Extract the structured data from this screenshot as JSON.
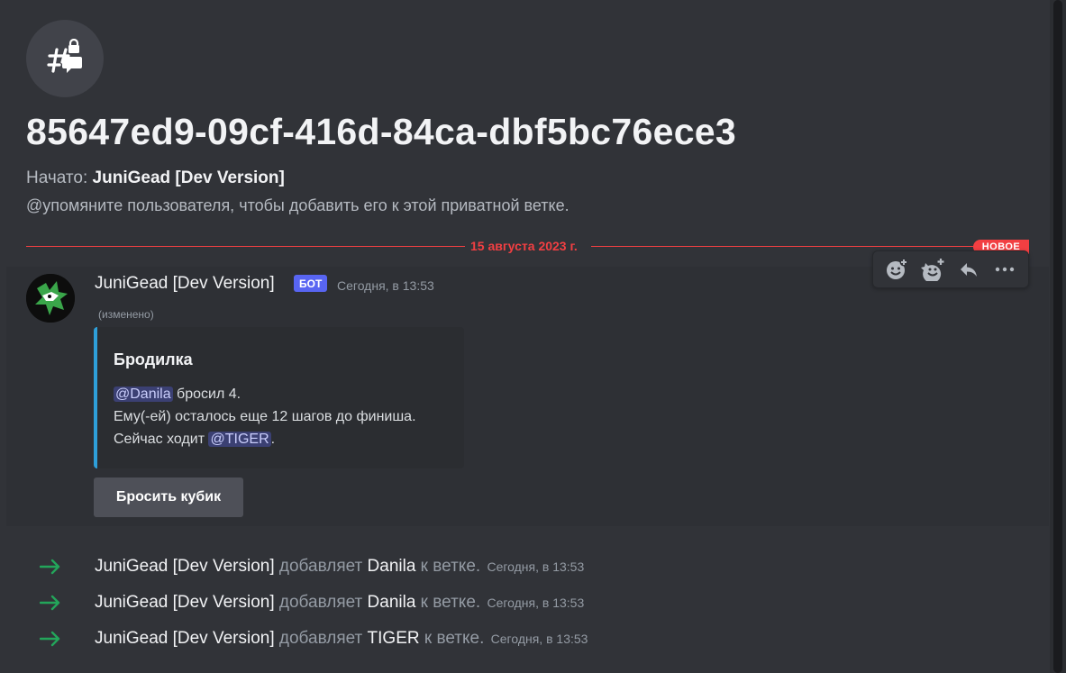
{
  "thread": {
    "title": "85647ed9-09cf-416d-84ca-dbf5bc76ece3",
    "started_label": "Начато:",
    "started_by": "JuniGead [Dev Version]",
    "mention_hint": "@упомяните пользователя, чтобы добавить его к этой приватной ветке."
  },
  "divider": {
    "date": "15 августа 2023 г.",
    "new_badge": "НОВОЕ"
  },
  "message": {
    "author": "JuniGead [Dev Version]",
    "bot_tag": "БОТ",
    "timestamp": "Сегодня, в 13:53",
    "edited": "(изменено)",
    "embed": {
      "title": "Бродилка",
      "mention1": "@Danila",
      "line1_rest": " бросил 4.",
      "line2": "Ему(-ей) осталось еще 12 шагов до финиша.",
      "line3_prefix": "Сейчас ходит ",
      "mention2": "@TIGER",
      "line3_suffix": ".",
      "accent_color": "#2e9fd9"
    },
    "button_label": "Бросить кубик"
  },
  "toolbar": {
    "icons": [
      "add-reaction-icon",
      "super-reaction-icon",
      "reply-icon",
      "more-icon"
    ]
  },
  "system_messages": [
    {
      "actor": "JuniGead [Dev Version]",
      "verb": " добавляет ",
      "target": "Danila",
      "suffix": " к ветке.",
      "time": "Сегодня, в 13:53"
    },
    {
      "actor": "JuniGead [Dev Version]",
      "verb": " добавляет ",
      "target": "Danila",
      "suffix": " к ветке.",
      "time": "Сегодня, в 13:53"
    },
    {
      "actor": "JuniGead [Dev Version]",
      "verb": " добавляет ",
      "target": "TIGER",
      "suffix": " к ветке.",
      "time": "Сегодня, в 13:53"
    }
  ],
  "colors": {
    "background": "#313338",
    "new_divider": "#f23f42",
    "bot_tag": "#5865f2",
    "join_arrow": "#23a55a"
  }
}
